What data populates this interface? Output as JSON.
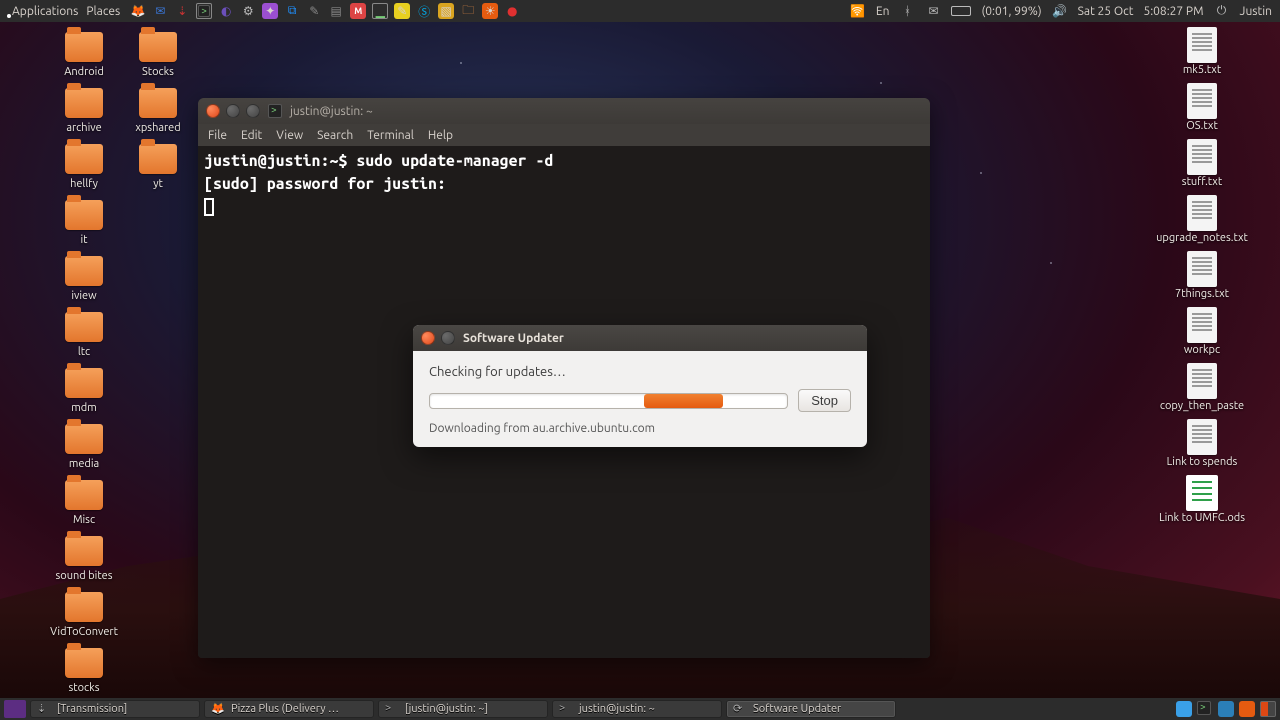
{
  "panel": {
    "applications": "Applications",
    "places": "Places",
    "lang": "En",
    "battery": "(0:01, 99%)",
    "date": "Sat 25 Oct",
    "time": "5:08:27 PM",
    "user": "Justin"
  },
  "desktop_left_col1": [
    {
      "label": "Android"
    },
    {
      "label": "archive"
    },
    {
      "label": "hellfy"
    },
    {
      "label": "it"
    },
    {
      "label": "iview"
    },
    {
      "label": "ltc"
    },
    {
      "label": "mdm"
    },
    {
      "label": "media"
    },
    {
      "label": "Misc"
    },
    {
      "label": "sound bites"
    },
    {
      "label": "VidToConvert"
    },
    {
      "label": "stocks"
    }
  ],
  "desktop_left_col2": [
    {
      "label": "Stocks"
    },
    {
      "label": "xpshared"
    },
    {
      "label": "yt"
    }
  ],
  "desktop_right": [
    {
      "type": "text",
      "label": "mk5.txt"
    },
    {
      "type": "text",
      "label": "OS.txt"
    },
    {
      "type": "text",
      "label": "stuff.txt"
    },
    {
      "type": "text",
      "label": "upgrade_notes.txt"
    },
    {
      "type": "text",
      "label": "7things.txt"
    },
    {
      "type": "text",
      "label": "workpc"
    },
    {
      "type": "text",
      "label": "copy_then_paste"
    },
    {
      "type": "text",
      "label": "Link to spends"
    },
    {
      "type": "ods",
      "label": "Link to UMFC.ods"
    }
  ],
  "terminal": {
    "title": "justin@justin: ~",
    "menus": [
      "File",
      "Edit",
      "View",
      "Search",
      "Terminal",
      "Help"
    ],
    "line1": "justin@justin:~$ sudo update-manager -d",
    "line2": "[sudo] password for justin:"
  },
  "updater": {
    "title": "Software Updater",
    "heading": "Checking for updates…",
    "stop": "Stop",
    "status": "Downloading from au.archive.ubuntu.com"
  },
  "taskbar": {
    "items": [
      {
        "label": "[Transmission]"
      },
      {
        "label": "Pizza Plus (Delivery …"
      },
      {
        "label": "[justin@justin: ~]"
      },
      {
        "label": "justin@justin: ~"
      },
      {
        "label": "Software Updater"
      }
    ]
  }
}
